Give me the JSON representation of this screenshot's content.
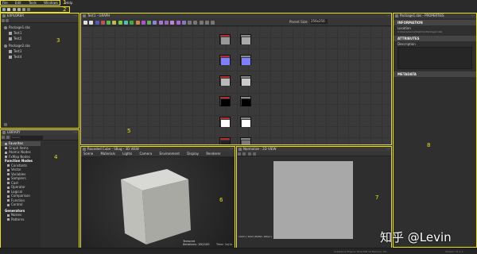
{
  "menu": {
    "items": [
      "File",
      "Edit",
      "Tools",
      "Windows",
      "Help"
    ]
  },
  "markers": {
    "m1": "1",
    "m2": "2",
    "m3": "3",
    "m4": "4",
    "m5": "5",
    "m6": "6",
    "m7": "7",
    "m8": "8"
  },
  "explorer": {
    "title": "EXPLORER",
    "packages": [
      {
        "name": "Package1.sbs",
        "items": [
          "Test1",
          "Test2"
        ]
      },
      {
        "name": "Package2.sbs",
        "items": [
          "Test3",
          "Test4"
        ]
      }
    ]
  },
  "graph": {
    "title": "Test1 - GRAPH",
    "resolution_label": "Parent Size:",
    "resolution_value": "256x256"
  },
  "library": {
    "title": "LIBRARY",
    "search_placeholder": "Search",
    "categories": [
      "Favorites",
      "Graph Items",
      "Atomic Nodes",
      "FxMap Nodes"
    ],
    "function_header": "Function Nodes",
    "function_items": [
      "Constants",
      "Vector",
      "Variables",
      "Samplers",
      "Cast",
      "Operator",
      "Logical",
      "Comparison",
      "Function",
      "Control"
    ],
    "generators_header": "Generators",
    "generator_items": [
      "Noises",
      "Patterns"
    ]
  },
  "view3d": {
    "title": "Rounded Cube - SBug - 3D VIEW",
    "menu": [
      "Scene",
      "Materials",
      "Lights",
      "Camera",
      "Environment",
      "Display",
      "Renderer"
    ],
    "overlay_lines": [
      "Textured",
      "Iterations: 100/100"
    ],
    "status_label": "3D Lanczos",
    "extra_line": "Time: 1s/1s"
  },
  "view2d": {
    "title": "Normalize - 2D VIEW",
    "status_text": "1024 x 1024 (RGBA, 16bpc)",
    "zoom": "Zoom: 100%"
  },
  "properties": {
    "title": "Package1.sbs - PROPERTIES",
    "information": "INFORMATION",
    "location_label": "Location",
    "location_value": "C:/Users/Levin/Desktop/Package1.sbs",
    "attributes": "ATTRIBUTES",
    "description_label": "Description",
    "metadata": "METADATA"
  },
  "statusbar": {
    "left": "Substance Engine: Direct3D 10 Memory: 0%",
    "right": "Version: 11.1.1"
  },
  "watermark": "知乎 @Levin"
}
